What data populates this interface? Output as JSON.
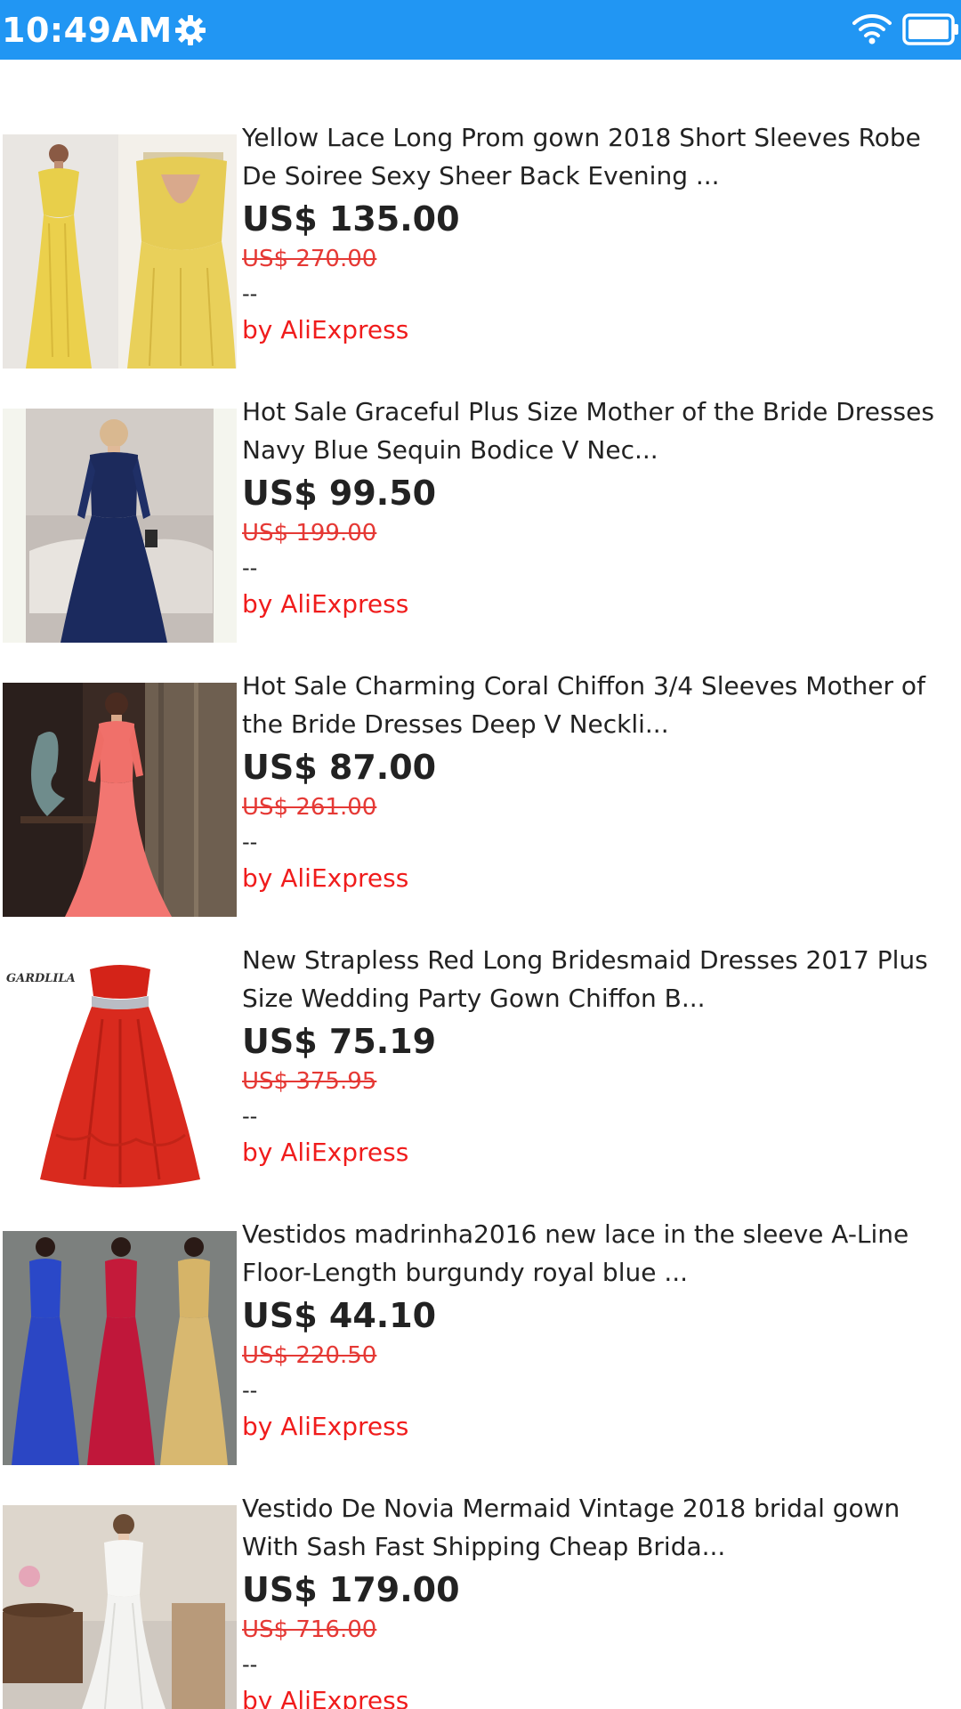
{
  "status_bar": {
    "time": "10:49AM",
    "settings_icon": "gear-icon",
    "wifi_icon": "wifi-icon",
    "battery_icon": "battery-icon",
    "color": "#2196f3"
  },
  "products": [
    {
      "title": "Yellow Lace Long Prom gown 2018 Short Sleeves Robe De Soiree Sexy Sheer Back Evening ...",
      "price": "US$ 135.00",
      "old_price": "US$ 270.00",
      "note": "--",
      "seller": "by AliExpress"
    },
    {
      "title": "Hot Sale Graceful Plus Size Mother of the Bride Dresses Navy Blue Sequin Bodice V Nec...",
      "price": "US$ 99.50",
      "old_price": "US$ 199.00",
      "note": "--",
      "seller": "by AliExpress"
    },
    {
      "title": "Hot Sale Charming Coral Chiffon 3/4 Sleeves Mother of the Bride Dresses Deep V Neckli...",
      "price": "US$ 87.00",
      "old_price": "US$ 261.00",
      "note": "--",
      "seller": "by AliExpress"
    },
    {
      "title": "New Strapless Red Long Bridesmaid Dresses 2017 Plus Size Wedding Party Gown Chiffon B...",
      "price": "US$ 75.19",
      "old_price": "US$ 375.95",
      "note": "--",
      "seller": "by AliExpress",
      "image_watermark": "GARDLILA"
    },
    {
      "title": "Vestidos madrinha2016 new lace in the sleeve A-Line Floor-Length burgundy royal blue ...",
      "price": "US$ 44.10",
      "old_price": "US$ 220.50",
      "note": "--",
      "seller": "by AliExpress"
    },
    {
      "title": "Vestido De Novia Mermaid Vintage 2018 bridal gown With Sash Fast Shipping Cheap Brida...",
      "price": "US$ 179.00",
      "old_price": "US$ 716.00",
      "note": "--",
      "seller": "by AliExpress"
    }
  ]
}
